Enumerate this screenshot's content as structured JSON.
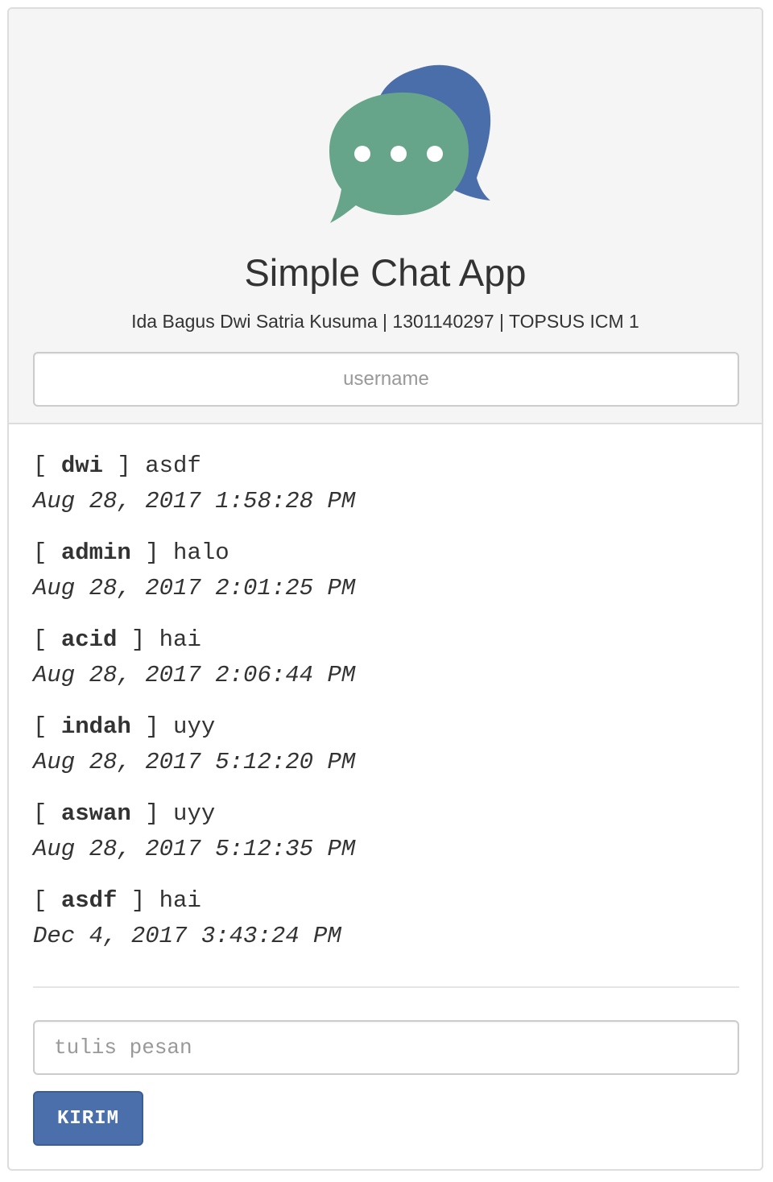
{
  "header": {
    "logo": "chat-bubbles-logo",
    "title": "Simple Chat App",
    "subtitle": "Ida Bagus Dwi Satria Kusuma | 1301140297 | TOPSUS ICM 1",
    "username_placeholder": "username"
  },
  "messages": [
    {
      "user": "dwi",
      "text": "asdf",
      "time": "Aug 28, 2017 1:58:28 PM"
    },
    {
      "user": "admin",
      "text": "halo",
      "time": "Aug 28, 2017 2:01:25 PM"
    },
    {
      "user": "acid",
      "text": "hai",
      "time": "Aug 28, 2017 2:06:44 PM"
    },
    {
      "user": "indah",
      "text": "uyy",
      "time": "Aug 28, 2017 5:12:20 PM"
    },
    {
      "user": "aswan",
      "text": "uyy",
      "time": "Aug 28, 2017 5:12:35 PM"
    },
    {
      "user": "asdf",
      "text": "hai",
      "time": "Dec 4, 2017 3:43:24 PM"
    }
  ],
  "composer": {
    "message_placeholder": "tulis pesan",
    "send_label": "KIRIM"
  },
  "colors": {
    "header_bg": "#f5f5f5",
    "bubble_back": "#4a6ea9",
    "bubble_front": "#67a58a",
    "button": "#4a6fab"
  }
}
